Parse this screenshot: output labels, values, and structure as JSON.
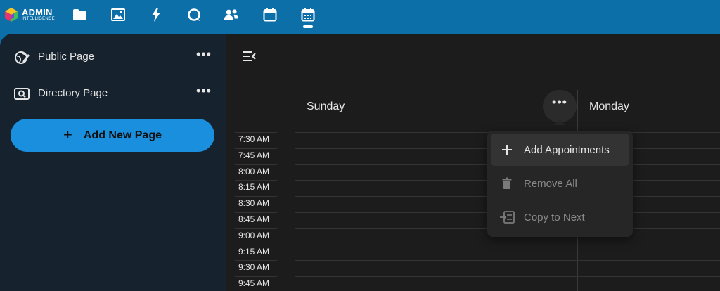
{
  "topbar": {
    "logo_line1": "ADMIN",
    "logo_line2": "INTELLIGENCE",
    "nav_icons": [
      "folder-icon",
      "image-icon",
      "lightning-icon",
      "chat-icon",
      "users-icon",
      "calendar-icon",
      "calendar-grid-icon"
    ],
    "active_nav": "calendar-grid-icon",
    "color": "#0d6fa8"
  },
  "sidebar": {
    "items": [
      {
        "label": "Public Page",
        "icon": "globe-edit-icon"
      },
      {
        "label": "Directory Page",
        "icon": "directory-icon"
      }
    ],
    "more_label": "•••",
    "add_button_label": "Add New Page",
    "add_button_icon": "+",
    "add_button_color": "#1a8fde"
  },
  "calendar": {
    "days": [
      "Sunday",
      "Monday"
    ],
    "times": [
      "7:30 AM",
      "7:45 AM",
      "8:00 AM",
      "8:15 AM",
      "8:30 AM",
      "8:45 AM",
      "9:00 AM",
      "9:15 AM",
      "9:30 AM",
      "9:45 AM"
    ],
    "day_more_label": "•••"
  },
  "dropdown": {
    "items": [
      {
        "label": "Add Appointments",
        "icon": "plus-icon",
        "enabled": true
      },
      {
        "label": "Remove All",
        "icon": "trash-icon",
        "enabled": false
      },
      {
        "label": "Copy to Next",
        "icon": "copy-next-icon",
        "enabled": false
      }
    ]
  }
}
